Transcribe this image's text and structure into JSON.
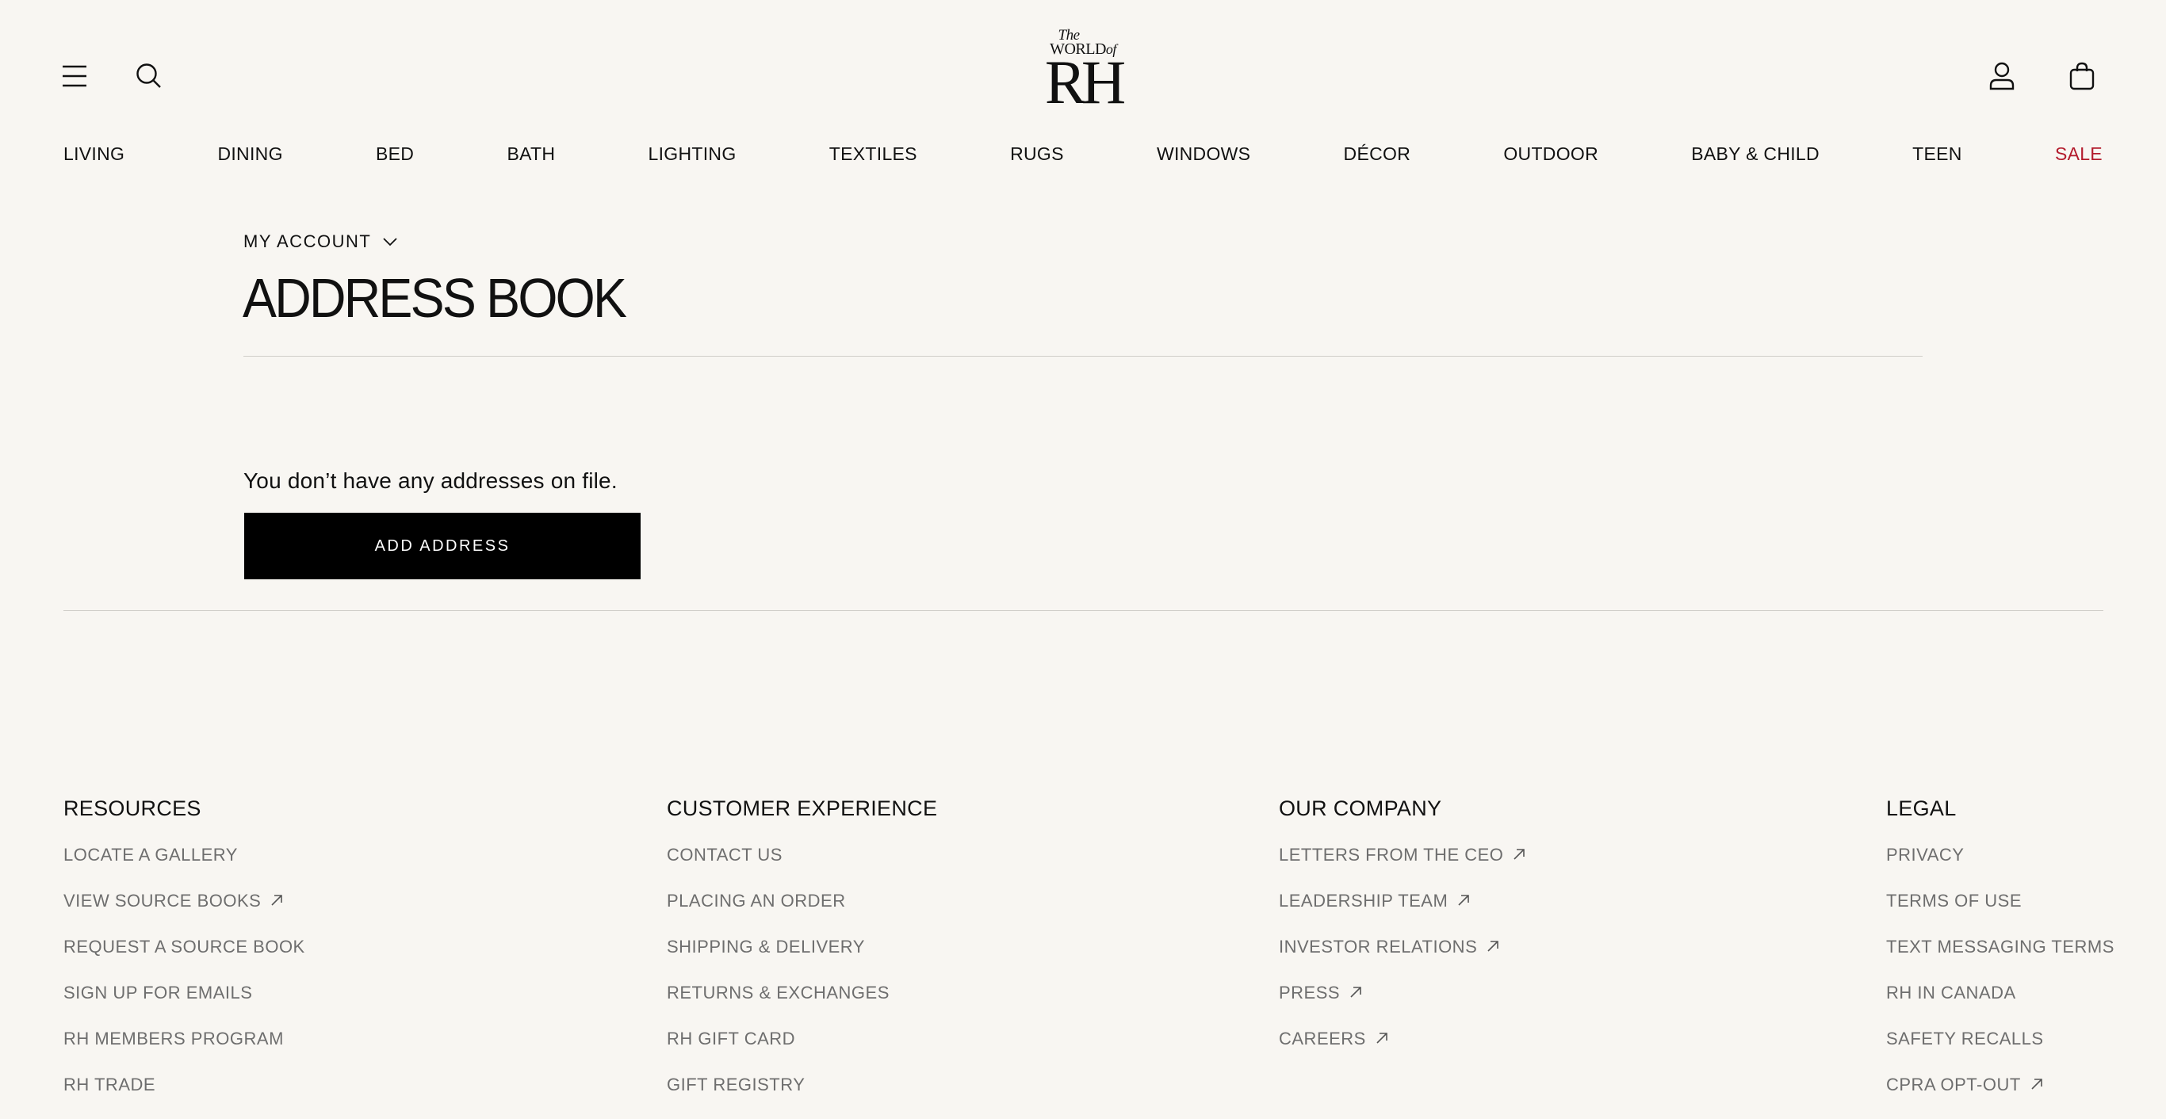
{
  "header": {
    "logo": {
      "line1": "The",
      "line2": "WORLD",
      "line2_suffix": "of",
      "mark": "RH"
    },
    "icons": {
      "menu": "hamburger-menu-icon",
      "search": "search-icon",
      "account": "user-icon",
      "cart": "shopping-bag-icon"
    }
  },
  "nav": {
    "items": [
      "LIVING",
      "DINING",
      "BED",
      "BATH",
      "LIGHTING",
      "TEXTILES",
      "RUGS",
      "WINDOWS",
      "DÉCOR",
      "OUTDOOR",
      "BABY & CHILD",
      "TEEN",
      "SALE"
    ],
    "sale_color": "#b31b2c"
  },
  "account": {
    "menu_label": "MY ACCOUNT",
    "page_title": "ADDRESS BOOK",
    "empty_message": "You don’t have any addresses on file.",
    "add_button": "ADD ADDRESS"
  },
  "footer": {
    "resources": {
      "title": "RESOURCES",
      "links": [
        {
          "label": "LOCATE A GALLERY",
          "external": false
        },
        {
          "label": "VIEW SOURCE BOOKS",
          "external": true
        },
        {
          "label": "REQUEST A SOURCE BOOK",
          "external": false
        },
        {
          "label": "SIGN UP FOR EMAILS",
          "external": false
        },
        {
          "label": "RH MEMBERS PROGRAM",
          "external": false
        },
        {
          "label": "RH TRADE",
          "external": false
        }
      ]
    },
    "customer_experience": {
      "title": "CUSTOMER EXPERIENCE",
      "links": [
        {
          "label": "CONTACT US",
          "external": false
        },
        {
          "label": "PLACING AN ORDER",
          "external": false
        },
        {
          "label": "SHIPPING & DELIVERY",
          "external": false
        },
        {
          "label": "RETURNS & EXCHANGES",
          "external": false
        },
        {
          "label": "RH GIFT CARD",
          "external": false
        },
        {
          "label": "GIFT REGISTRY",
          "external": false
        }
      ]
    },
    "our_company": {
      "title": "OUR COMPANY",
      "links": [
        {
          "label": "LETTERS FROM THE CEO",
          "external": true
        },
        {
          "label": "LEADERSHIP TEAM",
          "external": true
        },
        {
          "label": "INVESTOR RELATIONS",
          "external": true
        },
        {
          "label": "PRESS",
          "external": true
        },
        {
          "label": "CAREERS",
          "external": true
        }
      ]
    },
    "legal": {
      "title": "LEGAL",
      "links": [
        {
          "label": "PRIVACY",
          "external": false
        },
        {
          "label": "TERMS OF USE",
          "external": false
        },
        {
          "label": "TEXT MESSAGING TERMS",
          "external": false
        },
        {
          "label": "RH IN CANADA",
          "external": false
        },
        {
          "label": "SAFETY RECALLS",
          "external": false
        },
        {
          "label": "CPRA OPT-OUT",
          "external": true
        }
      ]
    }
  }
}
